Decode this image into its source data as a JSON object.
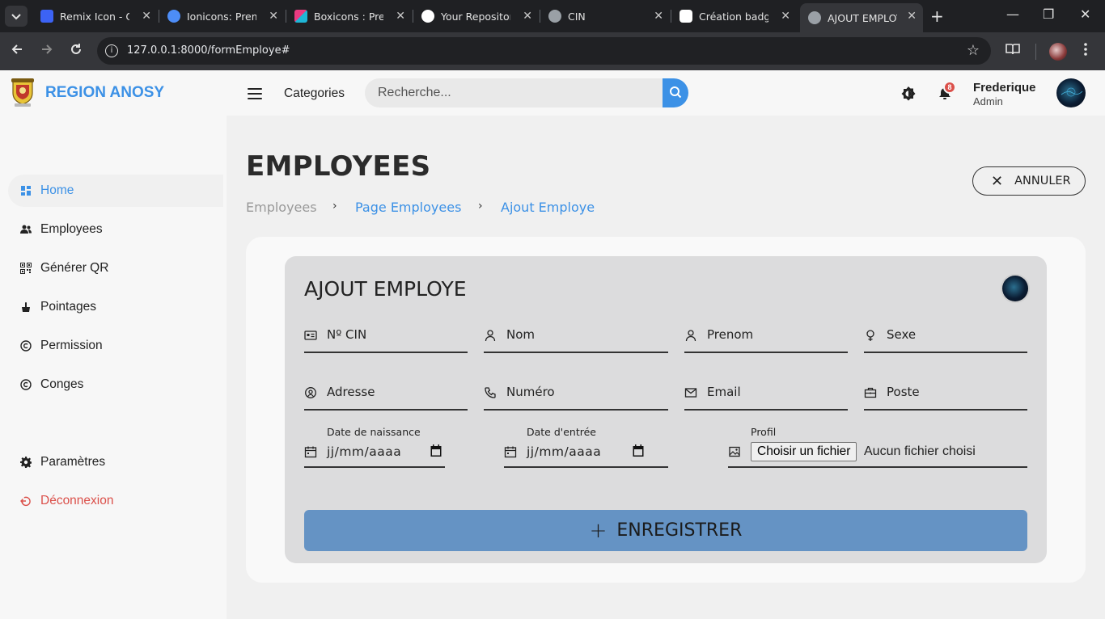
{
  "browser": {
    "tabs": [
      {
        "title": "Remix Icon - Ope",
        "favicon_color": "#3c63f5",
        "active": false
      },
      {
        "title": "Ionicons: Premiu",
        "favicon_color": "#4d8df7",
        "active": false
      },
      {
        "title": "Boxicons : Premi",
        "favicon_color": "#e93b81",
        "active": false
      },
      {
        "title": "Your Repositorie",
        "favicon_color": "#ffffff",
        "active": false
      },
      {
        "title": "CIN",
        "favicon_color": "#9aa0a6",
        "active": false
      },
      {
        "title": "Création badge",
        "favicon_color": "#ffffff",
        "active": false
      },
      {
        "title": "AJOUT EMPLOYE",
        "favicon_color": "#9aa0a6",
        "active": true
      }
    ],
    "url": "127.0.0.1:8000/formEmploye#"
  },
  "header": {
    "brand": "REGION ANOSY",
    "categories_label": "Categories",
    "search_placeholder": "Recherche...",
    "notification_count": "8",
    "user_name": "Frederique",
    "user_role": "Admin"
  },
  "sidebar": {
    "items": [
      {
        "label": "Home",
        "icon": "dashboard-icon",
        "active": true
      },
      {
        "label": "Employees",
        "icon": "users-icon"
      },
      {
        "label": "Générer QR",
        "icon": "qr-icon"
      },
      {
        "label": "Pointages",
        "icon": "pointer-icon"
      },
      {
        "label": "Permission",
        "icon": "copyright-icon"
      },
      {
        "label": "Conges",
        "icon": "copyright-icon"
      }
    ],
    "settings_label": "Paramètres",
    "logout_label": "Déconnexion"
  },
  "main": {
    "page_title": "EMPLOYEES",
    "breadcrumb": [
      "Employees",
      "Page Employees",
      "Ajout Employe"
    ],
    "cancel_label": "ANNULER",
    "form": {
      "title": "AJOUT EMPLOYE",
      "fields": {
        "cin": "Nº CIN",
        "nom": "Nom",
        "prenom": "Prenom",
        "sexe": "Sexe",
        "adresse": "Adresse",
        "numero": "Numéro",
        "email": "Email",
        "poste": "Poste"
      },
      "date_naissance_label": "Date de naissance",
      "date_entree_label": "Date d'entrée",
      "date_placeholder": "jj/mm/aaaa",
      "profil_label": "Profil",
      "file_button": "Choisir un fichier",
      "file_status": "Aucun fichier choisi",
      "submit_label": "ENREGISTRER"
    }
  },
  "colors": {
    "accent": "#3c91e6",
    "danger": "#db504a",
    "submit": "#6593c4"
  }
}
